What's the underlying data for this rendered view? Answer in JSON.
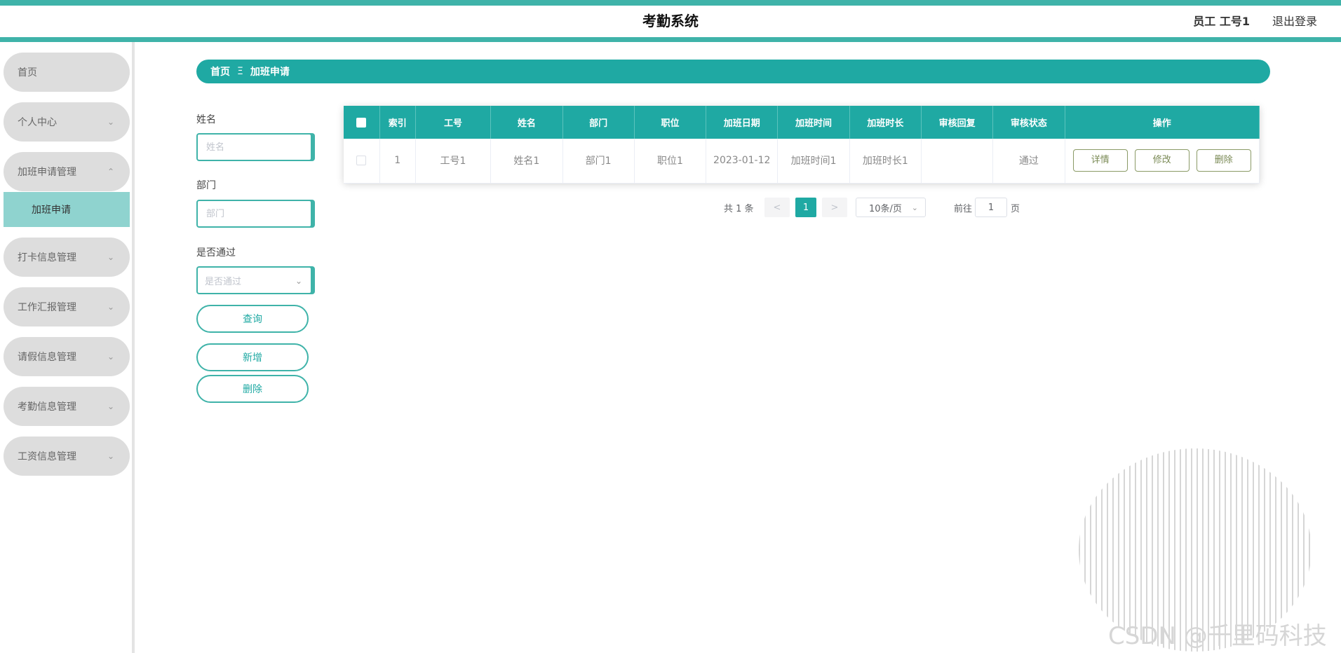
{
  "header": {
    "title": "考勤系统",
    "user": "员工 工号1",
    "logout": "退出登录"
  },
  "sidebar": {
    "items": [
      {
        "label": "首页"
      },
      {
        "label": "个人中心"
      },
      {
        "label": "加班申请管理"
      },
      {
        "label": "打卡信息管理"
      },
      {
        "label": "工作汇报管理"
      },
      {
        "label": "请假信息管理"
      },
      {
        "label": "考勤信息管理"
      },
      {
        "label": "工资信息管理"
      }
    ],
    "active_sub": "加班申请"
  },
  "breadcrumb": {
    "home": "首页",
    "separator": "Ξ",
    "current": "加班申请"
  },
  "filters": {
    "name_label": "姓名",
    "name_placeholder": "姓名",
    "dept_label": "部门",
    "dept_placeholder": "部门",
    "pass_label": "是否通过",
    "pass_placeholder": "是否通过",
    "query": "查询",
    "add": "新增",
    "delete": "删除"
  },
  "table": {
    "headers": [
      "索引",
      "工号",
      "姓名",
      "部门",
      "职位",
      "加班日期",
      "加班时间",
      "加班时长",
      "审核回复",
      "审核状态",
      "操作"
    ],
    "rows": [
      {
        "index": "1",
        "emp_no": "工号1",
        "name": "姓名1",
        "dept": "部门1",
        "position": "职位1",
        "date": "2023-01-12",
        "time": "加班时间1",
        "duration": "加班时长1",
        "reply": "",
        "status": "通过",
        "actions": {
          "detail": "详情",
          "edit": "修改",
          "delete": "删除"
        }
      }
    ]
  },
  "pagination": {
    "total": "共 1 条",
    "prev": "<",
    "current": "1",
    "next": ">",
    "page_size": "10条/页",
    "goto_label": "前往",
    "goto_value": "1",
    "page_suffix": "页"
  },
  "watermark": "CSDN @千里码科技",
  "colors": {
    "accent": "#1fa9a3",
    "border": "#3fb3a9",
    "menu_bg": "#dddddd",
    "active_sub_bg": "#8fd3cf"
  }
}
